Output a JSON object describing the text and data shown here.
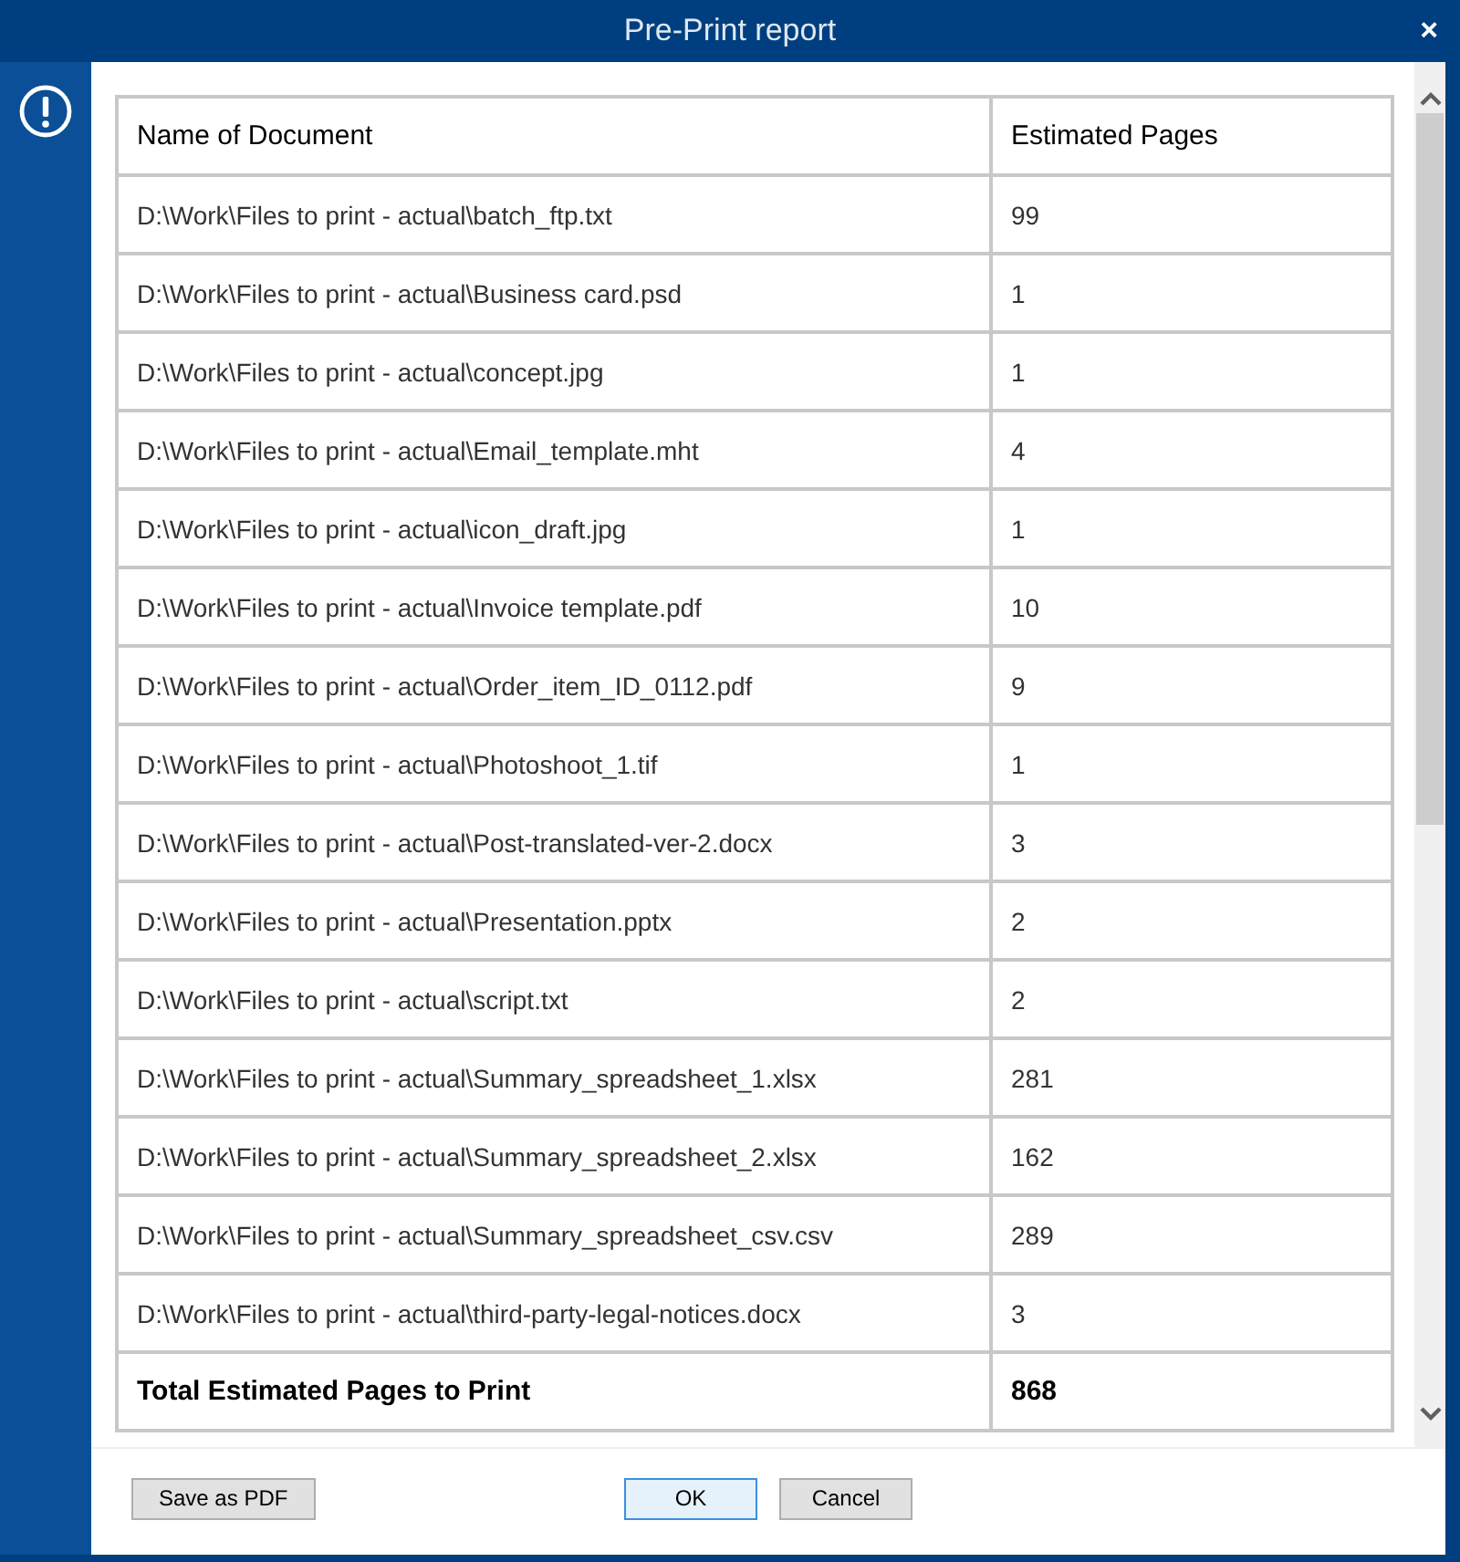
{
  "window": {
    "title": "Pre-Print report",
    "close": "×"
  },
  "table": {
    "columns": [
      "Name of Document",
      "Estimated Pages"
    ],
    "rows": [
      {
        "name": "D:\\Work\\Files to print - actual\\batch_ftp.txt",
        "pages": "99"
      },
      {
        "name": "D:\\Work\\Files to print - actual\\Business card.psd",
        "pages": "1"
      },
      {
        "name": "D:\\Work\\Files to print - actual\\concept.jpg",
        "pages": "1"
      },
      {
        "name": "D:\\Work\\Files to print - actual\\Email_template.mht",
        "pages": "4"
      },
      {
        "name": "D:\\Work\\Files to print - actual\\icon_draft.jpg",
        "pages": "1"
      },
      {
        "name": "D:\\Work\\Files to print - actual\\Invoice template.pdf",
        "pages": "10"
      },
      {
        "name": "D:\\Work\\Files to print - actual\\Order_item_ID_0112.pdf",
        "pages": "9"
      },
      {
        "name": "D:\\Work\\Files to print - actual\\Photoshoot_1.tif",
        "pages": "1"
      },
      {
        "name": "D:\\Work\\Files to print - actual\\Post-translated-ver-2.docx",
        "pages": "3"
      },
      {
        "name": "D:\\Work\\Files to print - actual\\Presentation.pptx",
        "pages": "2"
      },
      {
        "name": "D:\\Work\\Files to print - actual\\script.txt",
        "pages": "2"
      },
      {
        "name": "D:\\Work\\Files to print - actual\\Summary_spreadsheet_1.xlsx",
        "pages": "281"
      },
      {
        "name": "D:\\Work\\Files to print - actual\\Summary_spreadsheet_2.xlsx",
        "pages": "162"
      },
      {
        "name": "D:\\Work\\Files to print - actual\\Summary_spreadsheet_csv.csv",
        "pages": "289"
      },
      {
        "name": "D:\\Work\\Files to print - actual\\third-party-legal-notices.docx",
        "pages": "3"
      }
    ],
    "total": {
      "label": "Total Estimated Pages to Print",
      "pages": "868"
    }
  },
  "buttons": [
    {
      "label": "Save as PDF",
      "kind": "left",
      "focused": false
    },
    {
      "label": "OK",
      "kind": "center",
      "focused": true
    },
    {
      "label": "Cancel",
      "kind": "center",
      "focused": false
    }
  ]
}
